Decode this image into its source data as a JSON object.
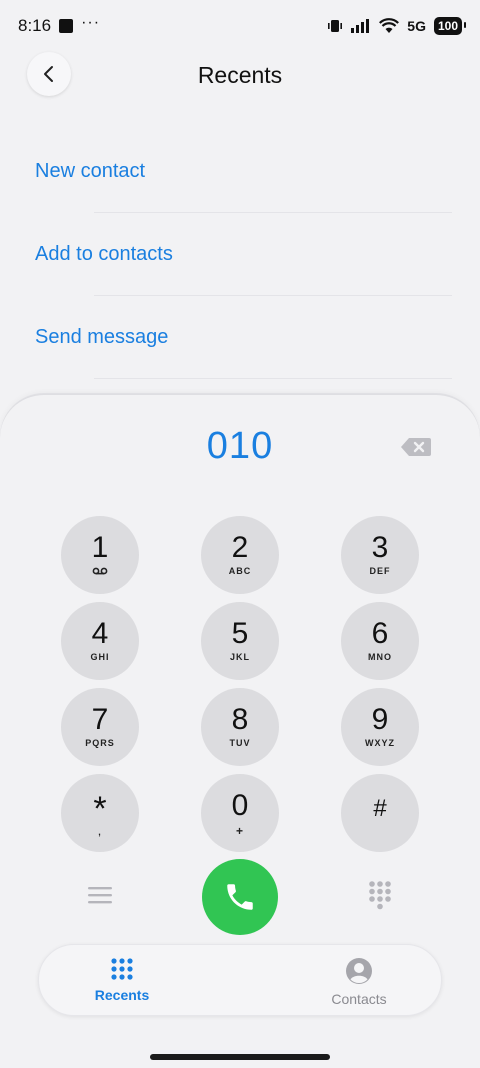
{
  "status_bar": {
    "time": "8:16",
    "network": "5G",
    "battery": "100",
    "icons": [
      "media-stop-icon",
      "more-dots-icon",
      "vibrate-icon",
      "signal-icon",
      "wifi-icon",
      "battery-icon"
    ]
  },
  "header": {
    "title": "Recents",
    "back_icon": "chevron-left-icon"
  },
  "actions": [
    {
      "label": "New contact"
    },
    {
      "label": "Add to contacts"
    },
    {
      "label": "Send message"
    }
  ],
  "dialer": {
    "number": "010",
    "backspace_icon": "backspace-icon",
    "keys": [
      {
        "digit": "1",
        "letters": "",
        "icon": "voicemail-icon"
      },
      {
        "digit": "2",
        "letters": "ABC"
      },
      {
        "digit": "3",
        "letters": "DEF"
      },
      {
        "digit": "4",
        "letters": "GHI"
      },
      {
        "digit": "5",
        "letters": "JKL"
      },
      {
        "digit": "6",
        "letters": "MNO"
      },
      {
        "digit": "7",
        "letters": "PQRS"
      },
      {
        "digit": "8",
        "letters": "TUV"
      },
      {
        "digit": "9",
        "letters": "WXYZ"
      },
      {
        "digit": "*",
        "letters": ","
      },
      {
        "digit": "0",
        "letters": "+"
      },
      {
        "digit": "#",
        "letters": ""
      }
    ],
    "call_color": "#31c553",
    "accent_color": "#1a7fe0"
  },
  "bottom_nav": {
    "tabs": [
      {
        "label": "Recents",
        "icon": "dialpad-grid-icon",
        "active": true
      },
      {
        "label": "Contacts",
        "icon": "person-icon",
        "active": false
      }
    ]
  }
}
